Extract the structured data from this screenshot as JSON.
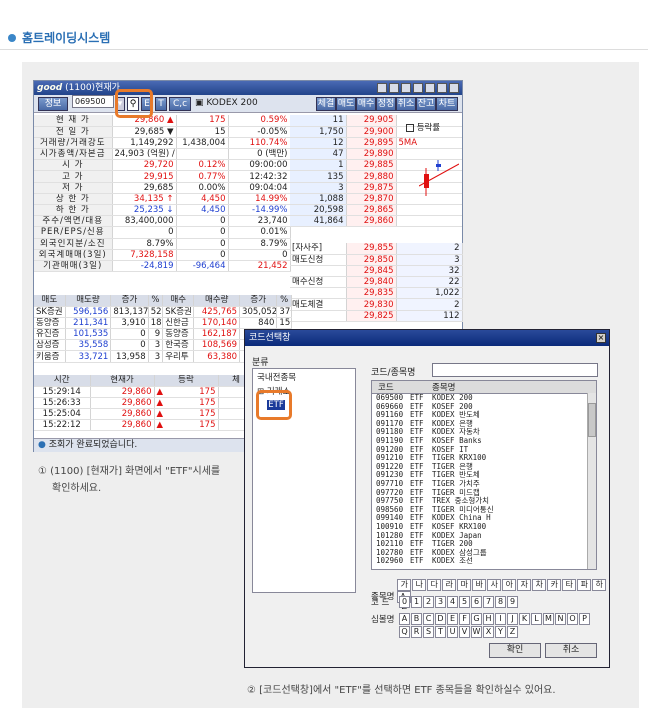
{
  "header": {
    "title": "홈트레이딩시스템"
  },
  "win1": {
    "logo": "good",
    "title": "(1100)현재가",
    "toolbar": {
      "left_btn": "정보",
      "code": "069500",
      "btn_c": "C,c",
      "name": "KODEX 200",
      "right_btns": [
        "체결",
        "매도",
        "매수",
        "정정",
        "취소",
        "잔고",
        "차트"
      ]
    },
    "quote_rows": [
      {
        "label": "현 재 가",
        "v1": "29,860 ▲",
        "v2": "175",
        "v3": "0.59%",
        "c1": "red",
        "c2": "red",
        "c3": "red"
      },
      {
        "label": "전 일 가",
        "v1": "29,685 ▼",
        "v2": "15",
        "v3": "-0.05%",
        "c1": "",
        "c2": "",
        "c3": ""
      },
      {
        "label": "거래량/거래강도",
        "v1": "1,149,292",
        "v2": "1,438,004",
        "v3": "110.74%",
        "c1": "",
        "c2": "",
        "c3": "red"
      },
      {
        "label": "시가총액/자본금",
        "v1": "24,903 (억원) /",
        "v2": "",
        "v3": "0 (백만)",
        "c1": "",
        "c2": "",
        "c3": ""
      },
      {
        "label": "시 가",
        "v1": "29,720",
        "v2": "0.12%",
        "v3": "09:00:00",
        "c1": "red",
        "c2": "red",
        "c3": ""
      },
      {
        "label": "고 가",
        "v1": "29,915",
        "v2": "0.77%",
        "v3": "12:42:32",
        "c1": "red",
        "c2": "red",
        "c3": ""
      },
      {
        "label": "저 가",
        "v1": "29,685",
        "v2": "0.00%",
        "v3": "09:04:04",
        "c1": "",
        "c2": "",
        "c3": ""
      },
      {
        "label": "상 한 가",
        "v1": "34,135 ↑",
        "v2": "4,450",
        "v3": "14.99%",
        "c1": "red",
        "c2": "red",
        "c3": "red"
      },
      {
        "label": "하 한 가",
        "v1": "25,235 ↓",
        "v2": "4,450",
        "v3": "-14.99%",
        "c1": "blue",
        "c2": "blue",
        "c3": "blue"
      },
      {
        "label": "주수/액면/대용",
        "v1": "83,400,000",
        "v2": "0",
        "v3": "23,740",
        "c1": "",
        "c2": "",
        "c3": ""
      },
      {
        "label": "PER/EPS/신용",
        "v1": "0",
        "v2": "0",
        "v3": "0.01%",
        "c1": "",
        "c2": "",
        "c3": ""
      },
      {
        "label": "외국인지분/소진",
        "v1": "8.79%",
        "v2": "0",
        "v3": "8.79%",
        "c1": "",
        "c2": "",
        "c3": ""
      },
      {
        "label": "외국계매매(3일)",
        "v1": "7,328,158",
        "v2": "0",
        "v3": "0",
        "c1": "red",
        "c2": "",
        "c3": ""
      },
      {
        "label": "기관매매(3일)",
        "v1": "-24,819",
        "v2": "-96,464",
        "v3": "21,452",
        "c1": "blue",
        "c2": "blue",
        "c3": "red"
      }
    ],
    "ask_rows": [
      {
        "qty": "11",
        "price": "29,905",
        "extra": ""
      },
      {
        "qty": "1,750",
        "price": "29,900",
        "extra": ""
      },
      {
        "qty": "12",
        "price": "29,895",
        "extra": "5MA"
      },
      {
        "qty": "47",
        "price": "29,890",
        "extra": ""
      },
      {
        "qty": "1",
        "price": "29,885",
        "extra": ""
      },
      {
        "qty": "135",
        "price": "29,880",
        "extra": ""
      },
      {
        "qty": "3",
        "price": "29,875",
        "extra": ""
      },
      {
        "qty": "1,088",
        "price": "29,870",
        "extra": ""
      },
      {
        "qty": "20,598",
        "price": "29,865",
        "extra": ""
      },
      {
        "qty": "41,864",
        "price": "29,860",
        "extra": ""
      }
    ],
    "checkbox_label": "등락률",
    "bid_rows": [
      {
        "label": "[자사주]",
        "price": "29,855",
        "qty": "2"
      },
      {
        "label": "매도신청",
        "price": "29,850",
        "qty": "3"
      },
      {
        "label": "",
        "price": "29,845",
        "qty": "32"
      },
      {
        "label": "매수신청",
        "price": "29,840",
        "qty": "22"
      },
      {
        "label": "",
        "price": "29,835",
        "qty": "1,022"
      },
      {
        "label": "매도체결",
        "price": "29,830",
        "qty": "2"
      },
      {
        "label": "",
        "price": "29,825",
        "qty": "112"
      }
    ],
    "broker_header": [
      "매도",
      "매도량",
      "증가",
      "%",
      "매수",
      "매수량",
      "증가",
      "%"
    ],
    "broker_rows": [
      [
        "SK증권",
        "596,156",
        "813,137",
        "52",
        "SK증권",
        "425,765",
        "305,052",
        "37"
      ],
      [
        "동양증",
        "211,341",
        "3,910",
        "18",
        "신한금",
        "170,140",
        "840",
        "15"
      ],
      [
        "유진증",
        "101,535",
        "0",
        "9",
        "동양증",
        "162,187",
        "",
        ""
      ],
      [
        "삼성증",
        "35,558",
        "0",
        "3",
        "한국증",
        "108,569",
        "",
        ""
      ],
      [
        "키움증",
        "33,721",
        "13,958",
        "3",
        "우리투",
        "63,380",
        "",
        ""
      ]
    ],
    "tick_header": [
      "시간",
      "현재가",
      "등락",
      "체"
    ],
    "tick_rows": [
      {
        "time": "15:29:14",
        "price": "29,860",
        "arrow": "▲",
        "chg": "175"
      },
      {
        "time": "15:26:33",
        "price": "29,860",
        "arrow": "▲",
        "chg": "175"
      },
      {
        "time": "15:25:04",
        "price": "29,860",
        "arrow": "▲",
        "chg": "175"
      },
      {
        "time": "15:22:12",
        "price": "29,860",
        "arrow": "▲",
        "chg": "175"
      }
    ],
    "status": "조회가 완료되었습니다."
  },
  "caption1": {
    "line1": "① (1100) [현재가] 화면에서 \"ETF\"시세를",
    "line2": "확인하세요."
  },
  "win2": {
    "title": "코드선택창",
    "close": "×",
    "category_label": "분류",
    "tree": [
      "국내전종목",
      "거래소",
      "ETF"
    ],
    "search_label": "코드/종목명",
    "search_value": "",
    "list_header": [
      "코드",
      "종목명"
    ],
    "list_rows": [
      [
        "069500",
        "ETF",
        "KODEX 200"
      ],
      [
        "069660",
        "ETF",
        "KOSEF 200"
      ],
      [
        "091160",
        "ETF",
        "KODEX 반도체"
      ],
      [
        "091170",
        "ETF",
        "KODEX 은행"
      ],
      [
        "091180",
        "ETF",
        "KODEX 자동차"
      ],
      [
        "091190",
        "ETF",
        "KOSEF Banks"
      ],
      [
        "091200",
        "ETF",
        "KOSEF IT"
      ],
      [
        "091210",
        "ETF",
        "TIGER KRX100"
      ],
      [
        "091220",
        "ETF",
        "TIGER 은행"
      ],
      [
        "091230",
        "ETF",
        "TIGER 반도체"
      ],
      [
        "097710",
        "ETF",
        "TIGER 가치주"
      ],
      [
        "097720",
        "ETF",
        "TIGER 미드캡"
      ],
      [
        "097750",
        "ETF",
        "TREX 중소형가치"
      ],
      [
        "098560",
        "ETF",
        "TIGER 미디어통신"
      ],
      [
        "099140",
        "ETF",
        "KODEX China H"
      ],
      [
        "100910",
        "ETF",
        "KOSEF KRX100"
      ],
      [
        "101280",
        "ETF",
        "KODEX Japan"
      ],
      [
        "102110",
        "ETF",
        "TIGER 200"
      ],
      [
        "102780",
        "ETF",
        "KODEX 삼성그룹"
      ],
      [
        "102960",
        "ETF",
        "KODEX 조선"
      ]
    ],
    "name_label": "종목명",
    "name_keys": [
      "가",
      "나",
      "다",
      "라",
      "마",
      "바",
      "사",
      "아",
      "자",
      "차",
      "카",
      "타",
      "파",
      "하",
      "A-Z"
    ],
    "code_label": "코 드",
    "code_keys": [
      "0",
      "1",
      "2",
      "3",
      "4",
      "5",
      "6",
      "7",
      "8",
      "9"
    ],
    "symbol_label": "심볼명",
    "symbol_keys_row1": [
      "A",
      "B",
      "C",
      "D",
      "E",
      "F",
      "G",
      "H",
      "I",
      "J",
      "K",
      "L",
      "M",
      "N",
      "O",
      "P"
    ],
    "symbol_keys_row2": [
      "Q",
      "R",
      "S",
      "T",
      "U",
      "V",
      "W",
      "X",
      "Y",
      "Z"
    ],
    "ok": "확인",
    "cancel": "취소"
  },
  "caption2": "② [코드선택창]에서 \"ETF\"를 선택하면 ETF 종목들을 확인하실수 있어요."
}
